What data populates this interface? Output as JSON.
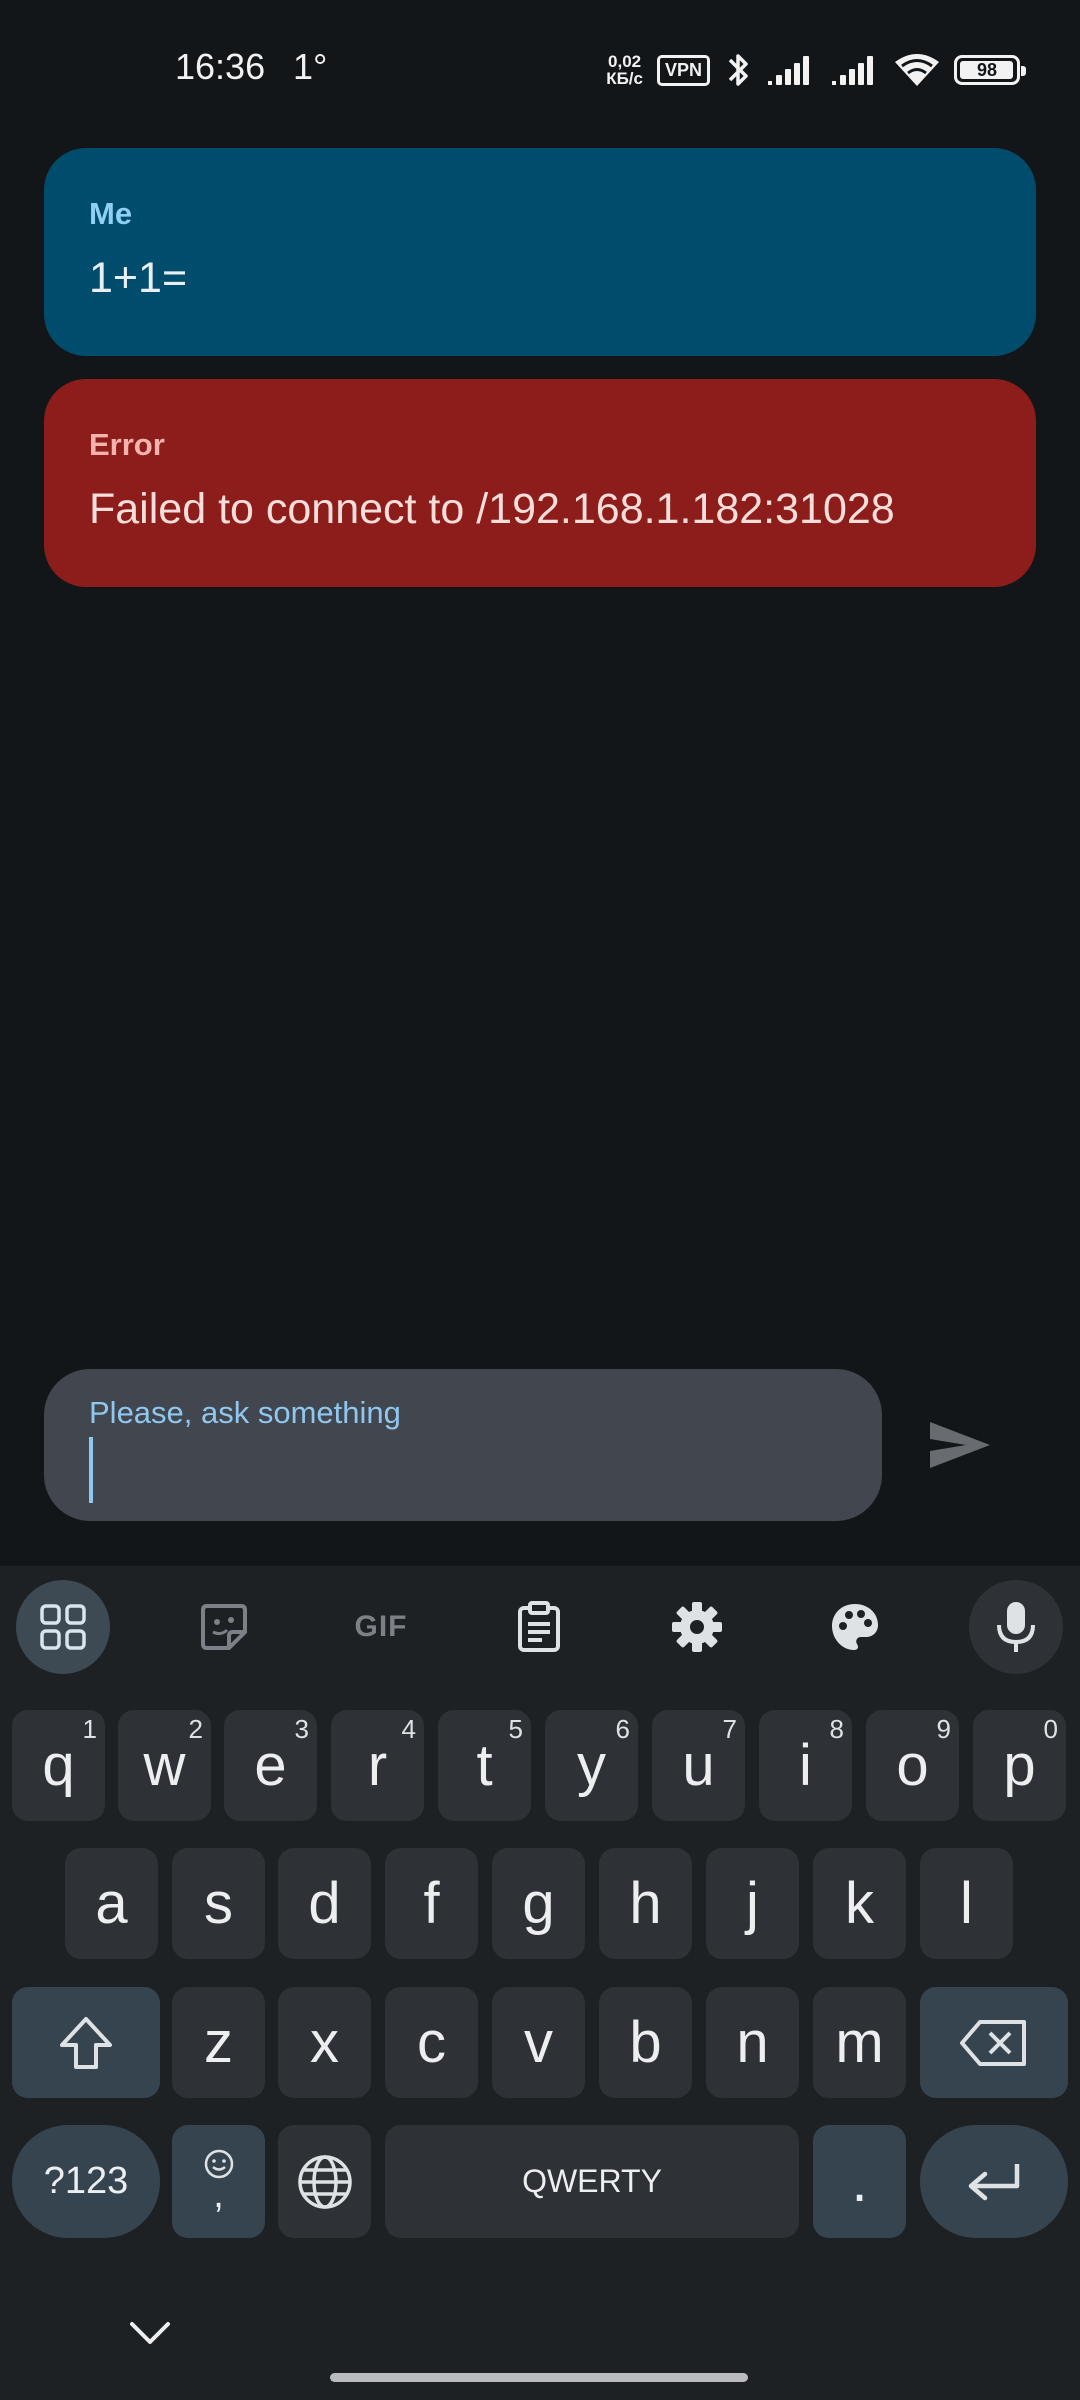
{
  "status_bar": {
    "time": "16:36",
    "temperature": "1°",
    "net_speed_value": "0,02",
    "net_speed_unit": "КБ/с",
    "vpn": "VPN",
    "battery": "98",
    "battery_level": 0.98,
    "icons": [
      "bluetooth-icon",
      "signal-icon",
      "signal-icon",
      "wifi-icon",
      "battery-icon"
    ]
  },
  "chat": {
    "messages": [
      {
        "sender": "Me",
        "text": "1+1=",
        "color": "#004c6c"
      },
      {
        "sender": "Error",
        "text": "Failed to connect to /192.168.1.182:31028",
        "color": "#8d1d1b"
      }
    ]
  },
  "composer": {
    "label": "Please, ask something",
    "value": "",
    "send_icon": "send-icon"
  },
  "keyboard": {
    "toolbar": [
      "apps-grid-icon",
      "sticker-icon",
      "gif-icon",
      "clipboard-icon",
      "settings-gear-icon",
      "palette-icon",
      "microphone-icon"
    ],
    "gif_label": "GIF",
    "row1": [
      {
        "label": "q",
        "hint": "1"
      },
      {
        "label": "w",
        "hint": "2"
      },
      {
        "label": "e",
        "hint": "3"
      },
      {
        "label": "r",
        "hint": "4"
      },
      {
        "label": "t",
        "hint": "5"
      },
      {
        "label": "y",
        "hint": "6"
      },
      {
        "label": "u",
        "hint": "7"
      },
      {
        "label": "i",
        "hint": "8"
      },
      {
        "label": "o",
        "hint": "9"
      },
      {
        "label": "p",
        "hint": "0"
      }
    ],
    "row2": [
      "a",
      "s",
      "d",
      "f",
      "g",
      "h",
      "j",
      "k",
      "l"
    ],
    "row3": [
      "z",
      "x",
      "c",
      "v",
      "b",
      "n",
      "m"
    ],
    "symbols_label": "?123",
    "emoji_comma_label": ",",
    "space_label": "QWERTY",
    "period_label": ".",
    "accent_color": "#364450"
  },
  "nav": {
    "hide_keyboard_icon": "chevron-down-icon"
  }
}
